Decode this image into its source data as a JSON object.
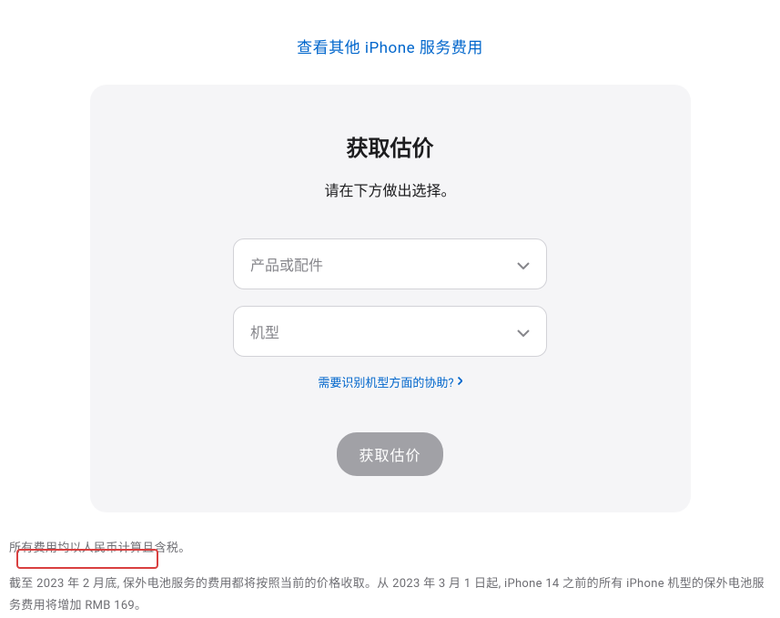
{
  "topLink": {
    "label": "查看其他 iPhone 服务费用"
  },
  "card": {
    "title": "获取估价",
    "subtitle": "请在下方做出选择。",
    "select1": {
      "placeholder": "产品或配件"
    },
    "select2": {
      "placeholder": "机型"
    },
    "helpLink": {
      "label": "需要识别机型方面的协助?"
    },
    "submitButton": {
      "label": "获取估价"
    }
  },
  "footnotes": {
    "line1": "所有费用均以人民币计算且含税。",
    "line2": "截至 2023 年 2 月底, 保外电池服务的费用都将按照当前的价格收取。从 2023 年 3 月 1 日起, iPhone 14 之前的所有 iPhone 机型的保外电池服务费用将增加 RMB 169。"
  }
}
